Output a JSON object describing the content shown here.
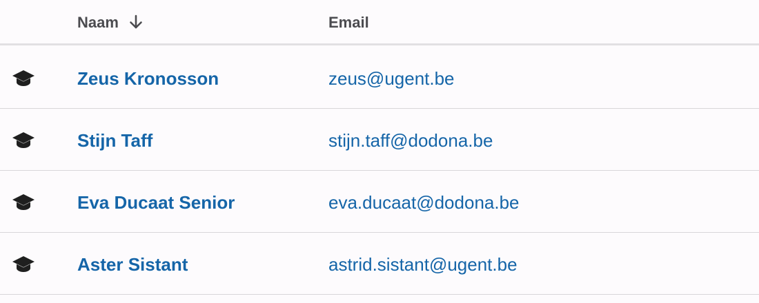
{
  "header": {
    "name_label": "Naam",
    "email_label": "Email",
    "sort_icon": "arrow-down-icon"
  },
  "rows": [
    {
      "role_icon": "graduation-cap-icon",
      "name": "Zeus Kronosson",
      "email": "zeus@ugent.be"
    },
    {
      "role_icon": "graduation-cap-icon",
      "name": "Stijn Taff",
      "email": "stijn.taff@dodona.be"
    },
    {
      "role_icon": "graduation-cap-icon",
      "name": "Eva Ducaat Senior",
      "email": "eva.ducaat@dodona.be"
    },
    {
      "role_icon": "graduation-cap-icon",
      "name": "Aster Sistant",
      "email": "astrid.sistant@ugent.be"
    }
  ],
  "colors": {
    "link": "#1565a8",
    "header_text": "#4b4b4f",
    "icon": "#1f1f1f",
    "background": "#fdfbfd"
  }
}
